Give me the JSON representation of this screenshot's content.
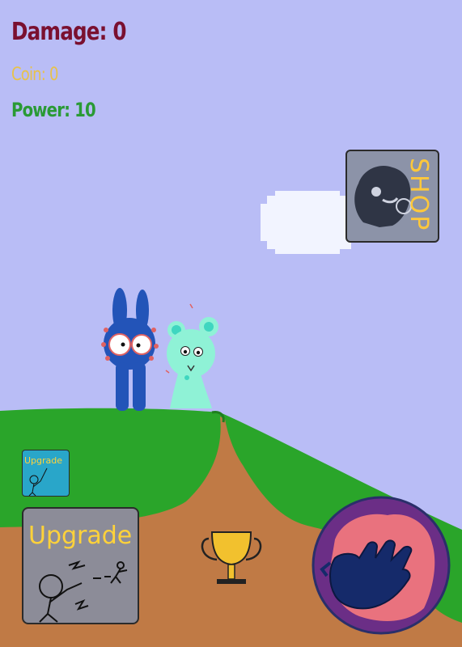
{
  "hud": {
    "damage": "Damage: 0",
    "coin": "Coin: 0",
    "power": "Power: 10"
  },
  "shop": {
    "label": "SHOP",
    "icon": "shop-character-icon"
  },
  "upgrade_small": {
    "label": "Upgrade",
    "icon": "stick-figure-icon"
  },
  "upgrade_big": {
    "label": "Upgrade",
    "icon": "stick-figure-punch-icon"
  },
  "trophy": {
    "icon": "trophy-icon"
  },
  "punch": {
    "icon": "fist-icon"
  },
  "colors": {
    "sky": "#b9bdf6",
    "grass": "#2aa52a",
    "dirt": "#c07a45",
    "damage_text": "#7a1030",
    "coin_text": "#e8c24a",
    "power_text": "#2a9a35",
    "upgrade_text": "#ffd23a",
    "punch_ring": "#6b2e86"
  }
}
